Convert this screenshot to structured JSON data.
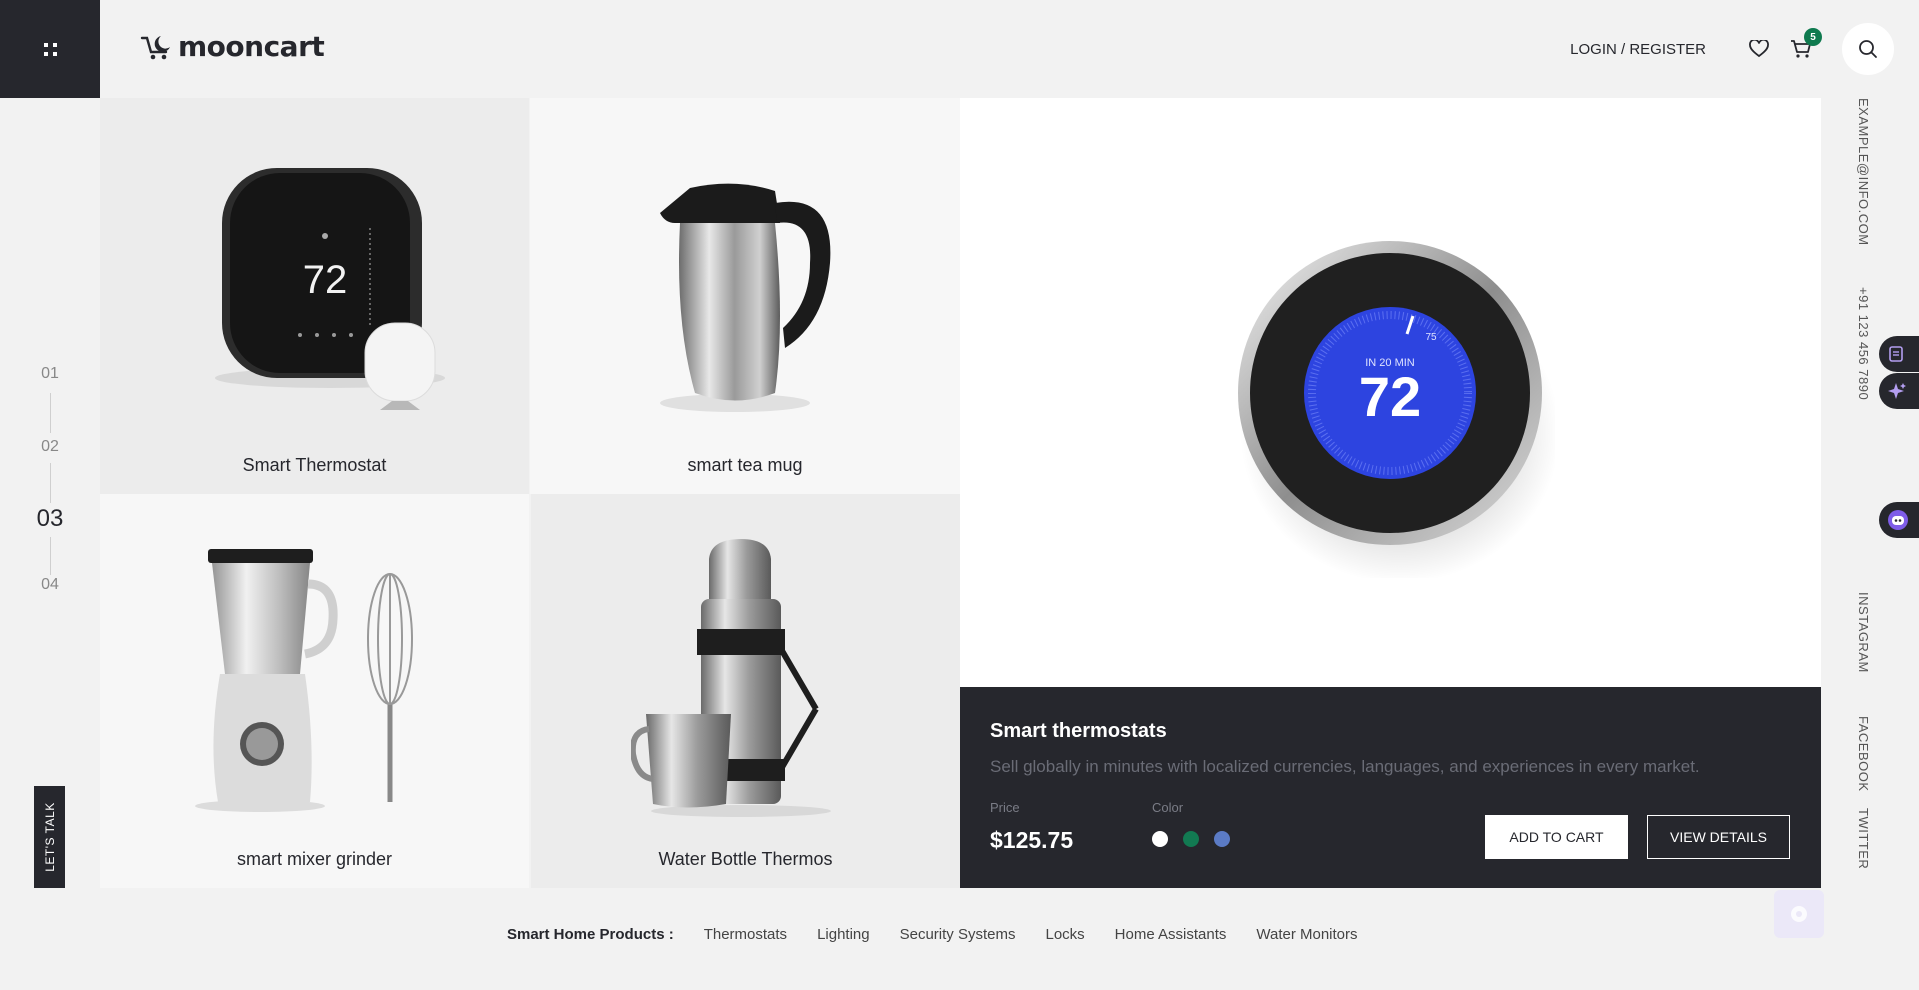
{
  "header": {
    "logo_text": "mooncart",
    "login_label": "LOGIN / REGISTER",
    "cart_count": "5"
  },
  "pager": {
    "items": [
      "01",
      "02",
      "03",
      "04"
    ],
    "active": "03"
  },
  "lets_talk": "LET'S TALK",
  "products": [
    {
      "name": "Smart Thermostat",
      "display": "72"
    },
    {
      "name": "smart tea mug"
    },
    {
      "name": "smart mixer grinder"
    },
    {
      "name": "Water Bottle Thermos"
    }
  ],
  "featured": {
    "display_caption": "IN 20 MIN",
    "display_temp": "72",
    "display_small": "75",
    "title": "Smart thermostats",
    "description": "Sell globally in minutes with localized currencies, languages, and experiences in every market.",
    "price_label": "Price",
    "price": "$125.75",
    "color_label": "Color",
    "colors": [
      "#ffffff",
      "#127a52",
      "#5b7bc5"
    ],
    "add_to_cart": "ADD TO CART",
    "view_details": "VIEW DETAILS"
  },
  "side": {
    "email": "EXAMPLE@INFO.COM",
    "phone": "+91 123 456 7890",
    "social": [
      "INSTAGRAM",
      "FACEBOOK",
      "TWITTER"
    ]
  },
  "categories": {
    "heading": "Smart Home Products :",
    "items": [
      "Thermostats",
      "Lighting",
      "Security Systems",
      "Locks",
      "Home Assistants",
      "Water Monitors"
    ]
  }
}
